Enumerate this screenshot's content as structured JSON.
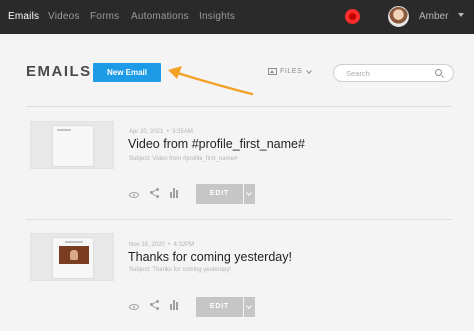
{
  "nav": {
    "items": [
      {
        "label": "Emails",
        "active": true
      },
      {
        "label": "Videos",
        "active": false
      },
      {
        "label": "Forms",
        "active": false
      },
      {
        "label": "Automations",
        "active": false
      },
      {
        "label": "Insights",
        "active": false
      }
    ],
    "username": "Amber",
    "record_color": "#ff2d2d"
  },
  "header": {
    "title": "EMAILS",
    "new_email_label": "New Email",
    "files_label": "FILES",
    "search_placeholder": "Search"
  },
  "colors": {
    "accent": "#1e9be6",
    "annotation_arrow": "#f3a026",
    "topbar": "#2a2a2a"
  },
  "emails": [
    {
      "date": "Apr 20, 2021",
      "time": "3:35AM",
      "title": "Video from #profile_first_name#",
      "subject": "Subject: Video from #profile_first_name#",
      "edit_label": "EDIT"
    },
    {
      "date": "Nov 16, 2020",
      "time": "4:32PM",
      "title": "Thanks for coming yesterday!",
      "subject": "Subject: Thanks for coming yesterday!",
      "edit_label": "EDIT"
    }
  ]
}
